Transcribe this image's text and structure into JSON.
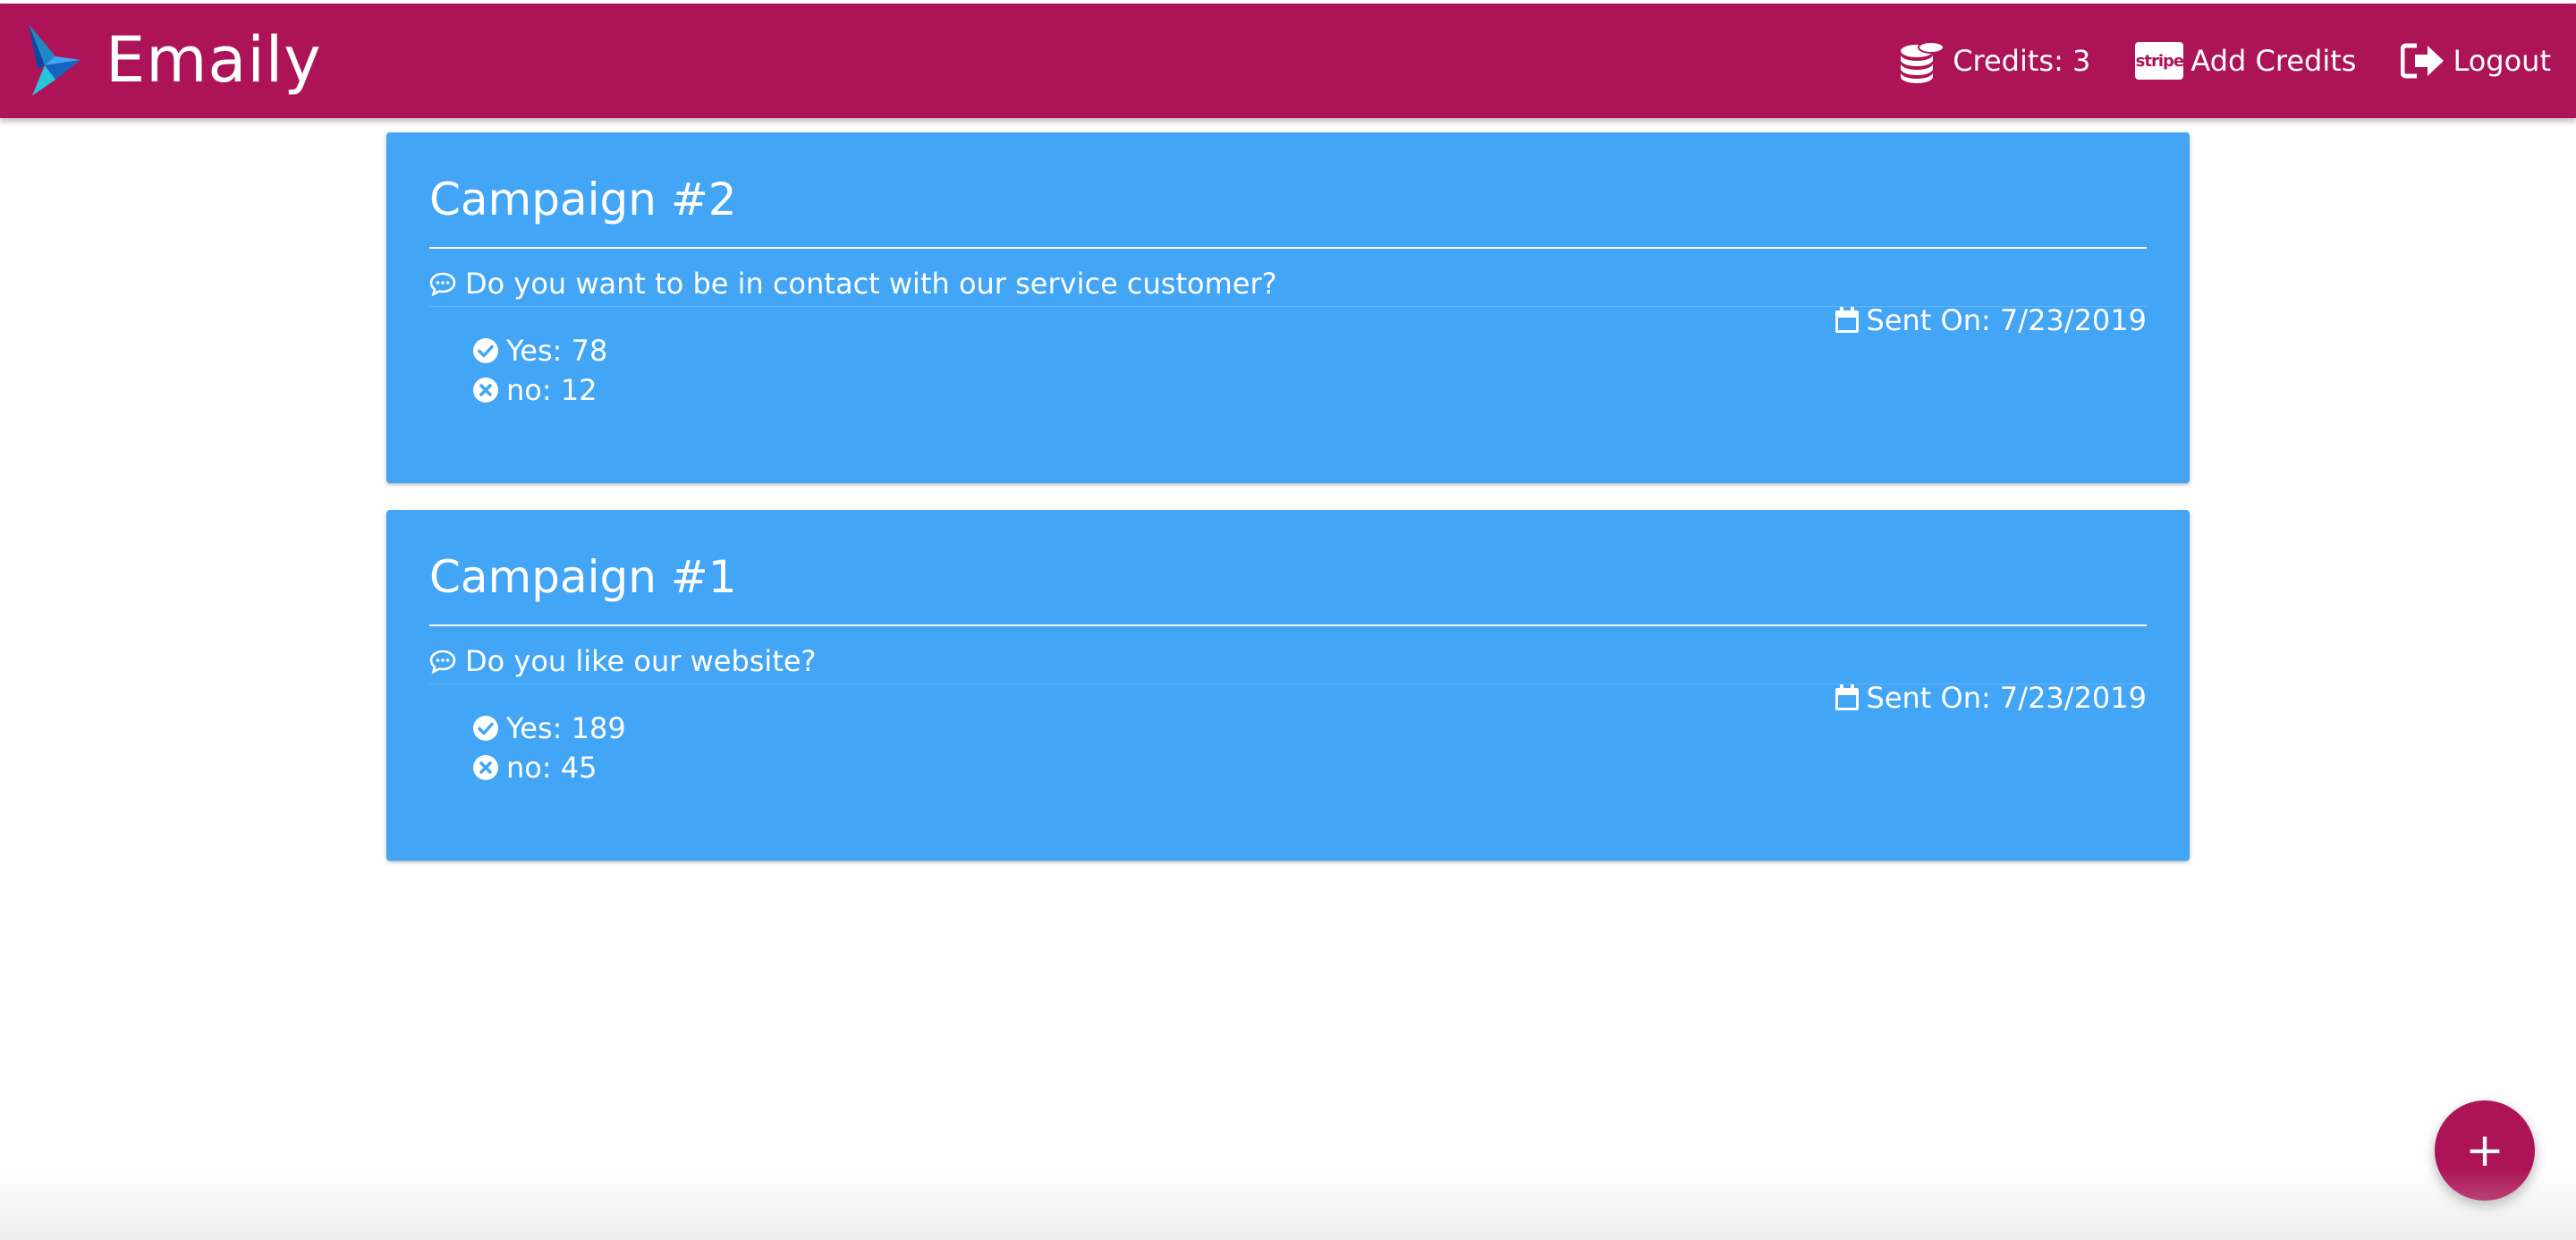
{
  "app": {
    "brand": "Emaily",
    "colors": {
      "primary": "#ad1457",
      "card": "#42a5f5",
      "text": "#ffffff"
    }
  },
  "nav": {
    "credits_label": "Credits: 3",
    "credits_icon": "coins-icon",
    "add_credits_label": "Add Credits",
    "add_credits_badge": "stripe",
    "logout_label": "Logout",
    "logout_icon": "sign-out-icon"
  },
  "surveys": [
    {
      "title": "Campaign #2",
      "question": "Do you want to be in contact with our service customer?",
      "sent_on": "Sent On: 7/23/2019",
      "yes": "Yes: 78",
      "no": "no: 12"
    },
    {
      "title": "Campaign #1",
      "question": "Do you like our website?",
      "sent_on": "Sent On: 7/23/2019",
      "yes": "Yes: 189",
      "no": "no: 45"
    }
  ],
  "fab": {
    "label": "+",
    "icon": "add-icon"
  }
}
